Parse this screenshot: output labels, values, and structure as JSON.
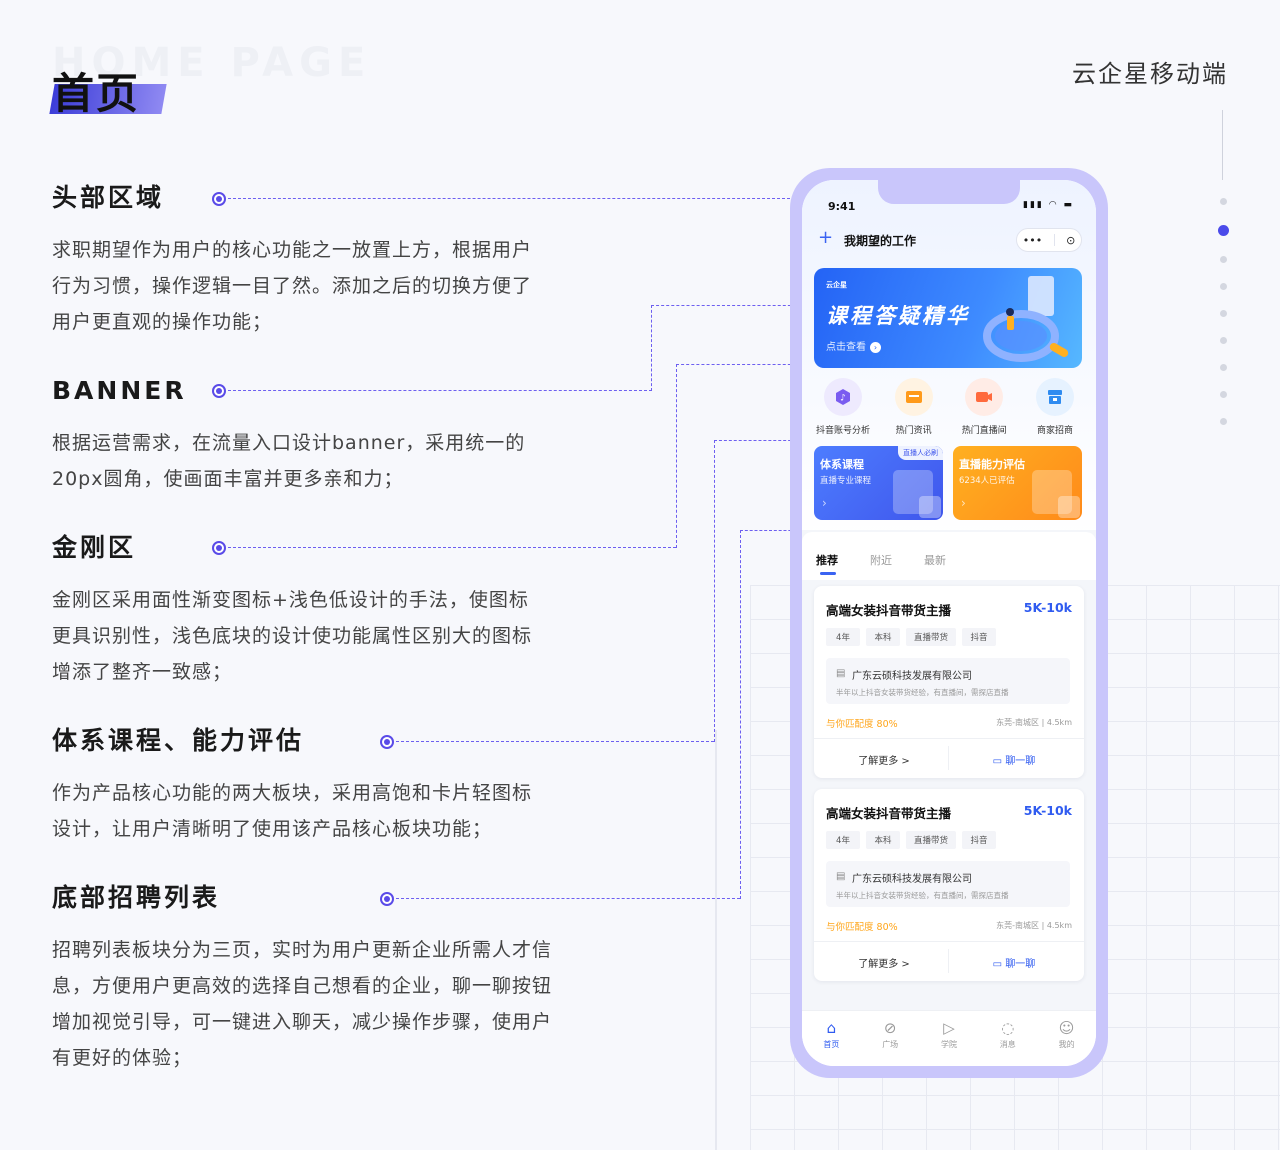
{
  "header": {
    "ghost_text": "HOME PAGE",
    "title": "首页",
    "brand": "云企星移动端"
  },
  "colors": {
    "accent": "#4b4bea",
    "primary_blue": "#2f5bf0",
    "orange": "#ff9a1a",
    "phone_frame": "#c9c6fb"
  },
  "sections": [
    {
      "title": "头部区域",
      "lines": [
        "求职期望作为用户的核心功能之一放置上方，根据用户",
        "行为习惯，操作逻辑一目了然。添加之后的切换方便了",
        "用户更直观的操作功能；"
      ]
    },
    {
      "title": "BANNER",
      "lines": [
        "根据运营需求，在流量入口设计banner，采用统一的",
        "20px圆角，使画面丰富并更多亲和力；"
      ]
    },
    {
      "title": "金刚区",
      "lines": [
        "金刚区采用面性渐变图标+浅色低设计的手法，使图标",
        "更具识别性，浅色底块的设计使功能属性区别大的图标",
        "增添了整齐一致感；"
      ]
    },
    {
      "title": "体系课程、能力评估",
      "lines": [
        "作为产品核心功能的两大板块，采用高饱和卡片轻图标",
        "设计，让用户清晰明了使用该产品核心板块功能；"
      ]
    },
    {
      "title": "底部招聘列表",
      "lines": [
        "招聘列表板块分为三页，实时为用户更新企业所需人才信",
        "息，方便用户更高效的选择自己想看的企业，聊一聊按钮",
        "增加视觉引导，可一键进入聊天，减少操作步骤，使用户",
        "有更好的体验；"
      ]
    }
  ],
  "phone": {
    "status_time": "9:41",
    "nav": {
      "title": "我期望的工作",
      "plus_icon": "plus-icon",
      "menu_icon": "more-dots-icon",
      "target_icon": "record-icon"
    },
    "banner": {
      "logo": "云企星",
      "title": "课程答疑精华",
      "subtitle": "点击查看"
    },
    "shortcuts": [
      {
        "label": "抖音账号分析",
        "icon": "tiktok-icon",
        "color": "#7a5cf0"
      },
      {
        "label": "热门资讯",
        "icon": "news-icon",
        "color": "#ff9a1a"
      },
      {
        "label": "热门直播间",
        "icon": "live-camera-icon",
        "color": "#ff6a3d"
      },
      {
        "label": "商家招商",
        "icon": "store-icon",
        "color": "#2f8bf0"
      }
    ],
    "course_cards": [
      {
        "title": "体系课程",
        "sub": "直播专业课程",
        "badge": "直播人必刷"
      },
      {
        "title": "直播能力评估",
        "sub": "6234人已评估",
        "badge": ""
      }
    ],
    "tabs": [
      "推荐",
      "附近",
      "最新"
    ],
    "jobs": [
      {
        "title": "高端女装抖音带货主播",
        "salary": "5K-10k",
        "tags": [
          "4年",
          "本科",
          "直播带货",
          "抖音"
        ],
        "company": "广东云硕科技发展有限公司",
        "desc": "半年以上抖音女装带货经验，有直播间，需探店直播",
        "match": "与你匹配度 80%",
        "location": "东莞-南城区 | 4.5km",
        "more": "了解更多 >",
        "chat": "聊一聊"
      },
      {
        "title": "高端女装抖音带货主播",
        "salary": "5K-10k",
        "tags": [
          "4年",
          "本科",
          "直播带货",
          "抖音"
        ],
        "company": "广东云硕科技发展有限公司",
        "desc": "半年以上抖音女装带货经验，有直播间，需探店直播",
        "match": "与你匹配度 80%",
        "location": "东莞-南城区 | 4.5km",
        "more": "了解更多 >",
        "chat": "聊一聊"
      }
    ],
    "tabbar": [
      {
        "label": "首页",
        "icon": "home-icon",
        "active": true
      },
      {
        "label": "广场",
        "icon": "compass-icon",
        "active": false
      },
      {
        "label": "学院",
        "icon": "video-icon",
        "active": false
      },
      {
        "label": "消息",
        "icon": "message-icon",
        "active": false
      },
      {
        "label": "我的",
        "icon": "profile-icon",
        "active": false
      }
    ]
  }
}
